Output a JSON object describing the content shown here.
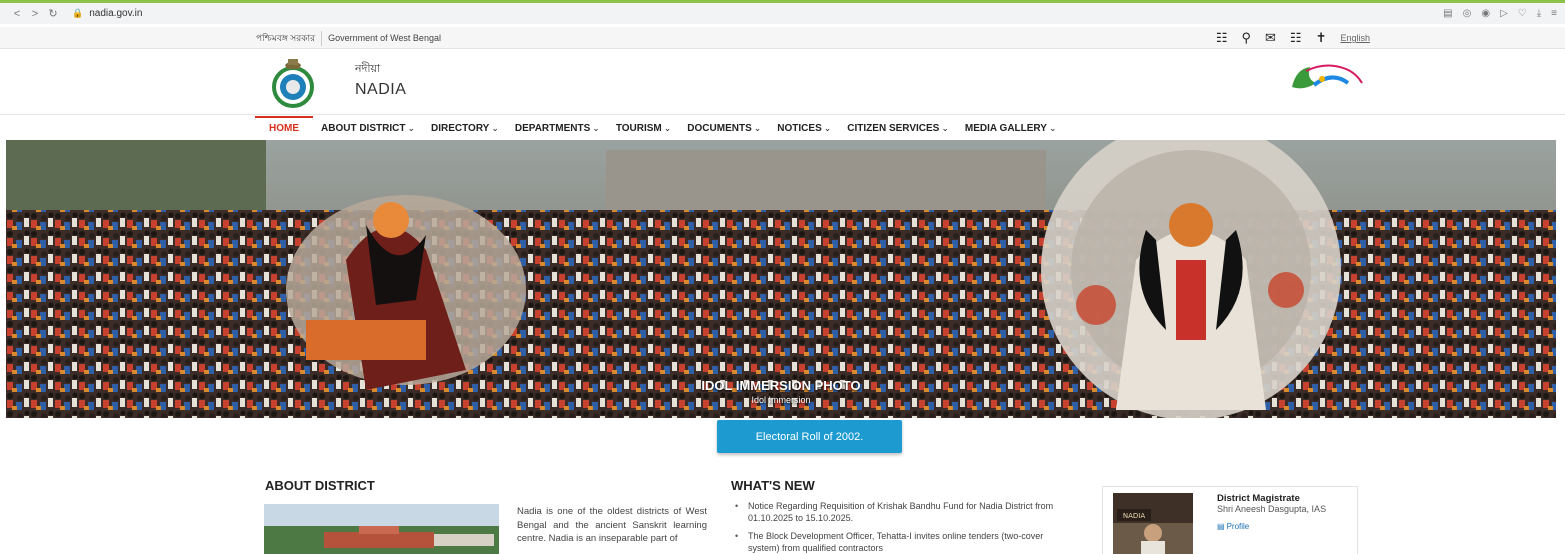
{
  "browser": {
    "back_icon": "back-arrow-icon",
    "forward_icon": "forward-arrow-icon",
    "reload_icon": "reload-icon",
    "url": "nadia.gov.in"
  },
  "gov_strip": {
    "bengali_label": "পশ্চিমবঙ্গ সরকার",
    "english_label": "Government of West Bengal",
    "language_link": "English"
  },
  "header": {
    "title_bengali": "নদীয়া",
    "title_english": "NADIA"
  },
  "nav": {
    "items": [
      {
        "label": "HOME"
      },
      {
        "label": "ABOUT DISTRICT"
      },
      {
        "label": "DIRECTORY"
      },
      {
        "label": "DEPARTMENTS"
      },
      {
        "label": "TOURISM"
      },
      {
        "label": "DOCUMENTS"
      },
      {
        "label": "NOTICES"
      },
      {
        "label": "CITIZEN SERVICES"
      },
      {
        "label": "MEDIA GALLERY"
      }
    ]
  },
  "hero": {
    "title": "IDOL IMMERSION PHOTO",
    "subtitle": "Idol Immersion"
  },
  "electoral": {
    "label": "Electoral Roll of 2002."
  },
  "about": {
    "heading": "ABOUT DISTRICT",
    "text": "Nadia is one of the oldest districts of West Bengal and the ancient Sanskrit learning centre. Nadia is an inseparable part of"
  },
  "whats_new": {
    "heading": "WHAT'S NEW",
    "items": [
      "Notice Regarding Requisition of Krishak Bandhu Fund for Nadia District from 01.10.2025 to 15.10.2025.",
      "The Block Development Officer, Tehatta-I invites online tenders (two-cover system) from qualified contractors"
    ]
  },
  "dm": {
    "title": "District Magistrate",
    "name": "Shri Aneesh Dasgupta, IAS",
    "profile_label": "Profile",
    "photo_sign": "NADIA"
  },
  "colors": {
    "accent_red": "#d9301d",
    "button_blue": "#1d9bd1",
    "link_blue": "#1a73b8"
  }
}
